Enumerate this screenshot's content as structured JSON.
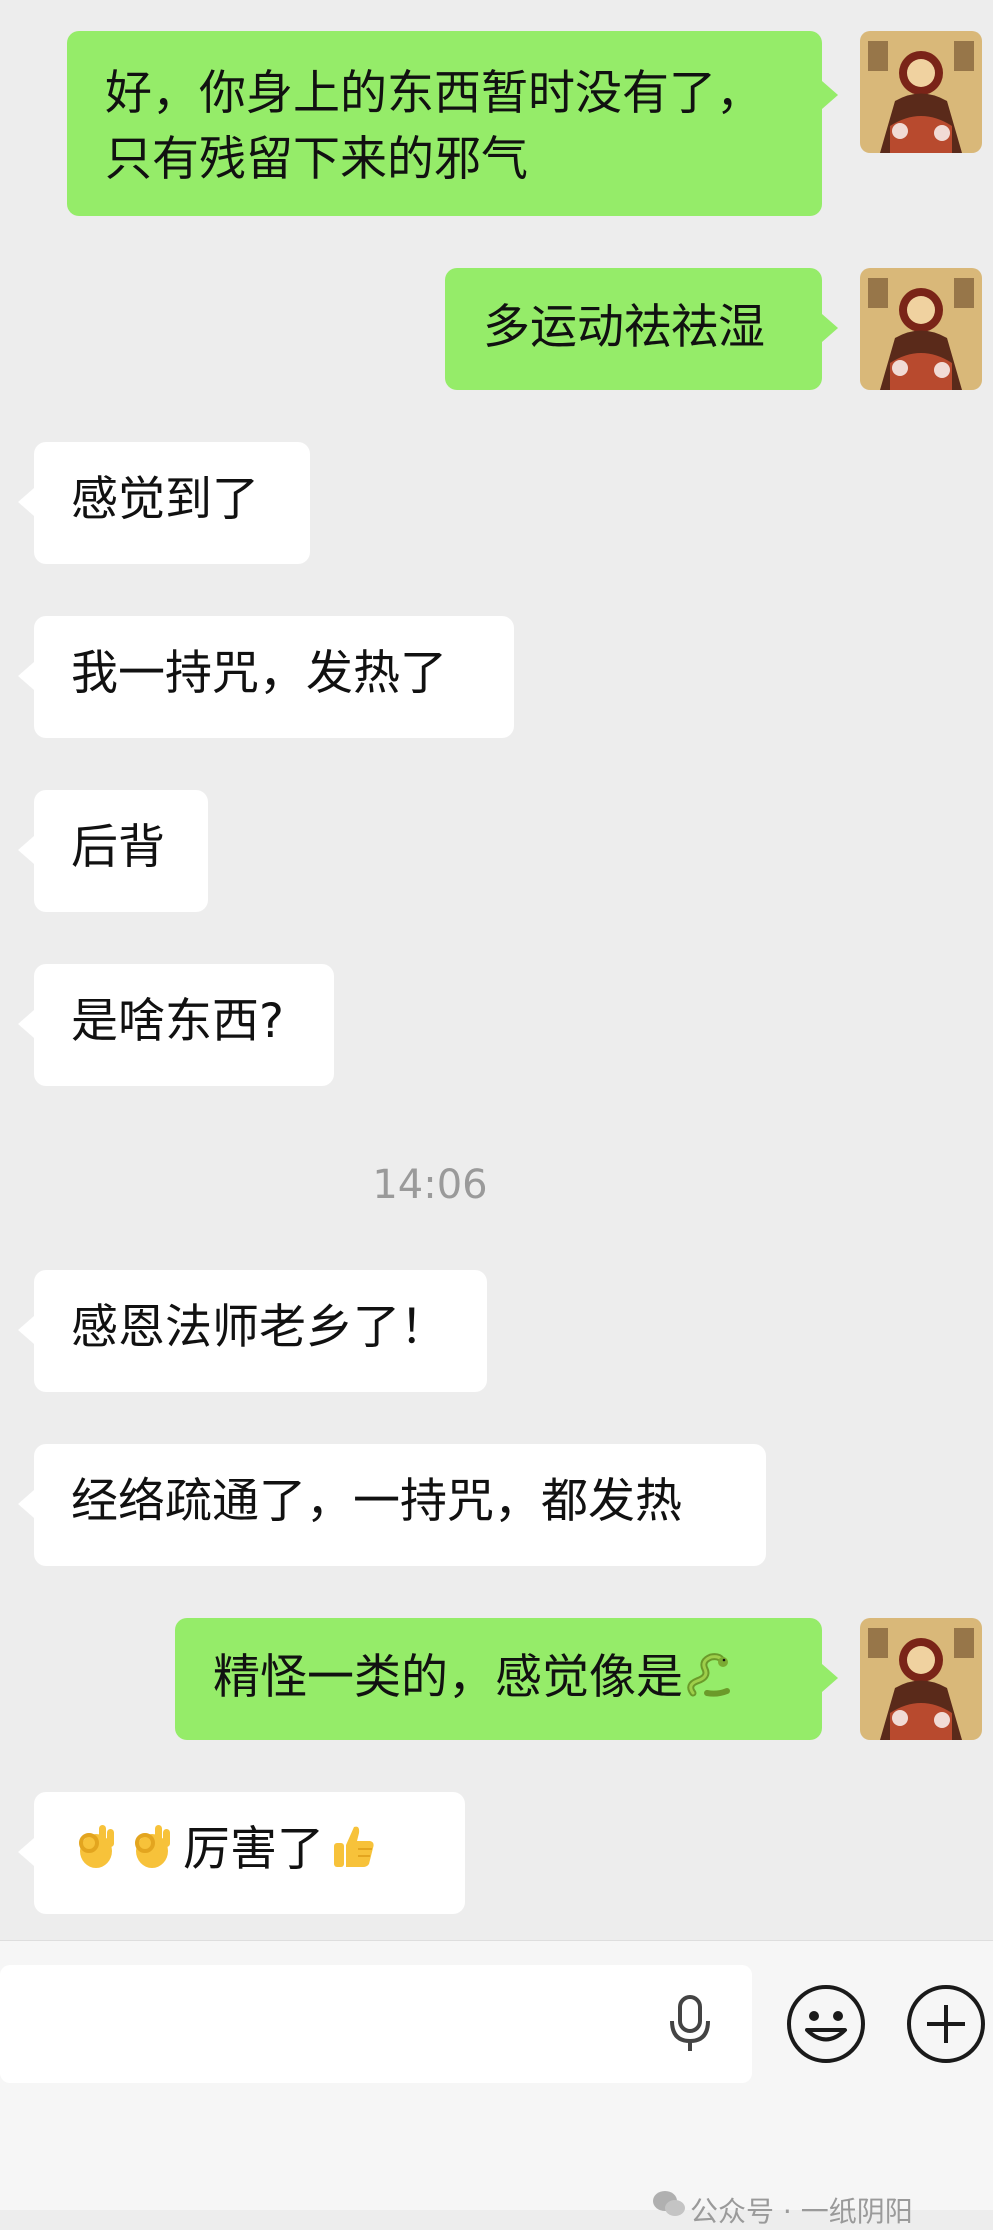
{
  "messages": [
    {
      "direction": "out",
      "lines": [
        "好，你身上的东西暂时没有了，",
        "只有残留下来的邪气"
      ]
    },
    {
      "direction": "out",
      "text": "多运动祛祛湿"
    },
    {
      "direction": "in",
      "text": "感觉到了"
    },
    {
      "direction": "in",
      "text": "我一持咒，发热了"
    },
    {
      "direction": "in",
      "text": "后背"
    },
    {
      "direction": "in",
      "text": "是啥东西?"
    },
    {
      "direction": "in",
      "text": "感恩法师老乡了！"
    },
    {
      "direction": "in",
      "text": "经络疏通了，一持咒，都发热"
    },
    {
      "direction": "out",
      "text": "精怪一类的，感觉像是",
      "emoji_after": "snake-emoji"
    },
    {
      "direction": "in",
      "emoji_before": [
        "ok-hand-emoji",
        "ok-hand-emoji"
      ],
      "text": "厉害了",
      "emoji_after": "thumbs-up-emoji"
    }
  ],
  "timestamp": "14:06",
  "watermark": "公众号 · 一纸阴阳",
  "colors": {
    "background": "#ededed",
    "outgoing_bubble": "#95ec69",
    "incoming_bubble": "#ffffff",
    "timestamp": "#9a9a9a"
  },
  "input_bar": {
    "icons": [
      "microphone-icon",
      "emoji-face-icon",
      "plus-circle-icon"
    ]
  }
}
